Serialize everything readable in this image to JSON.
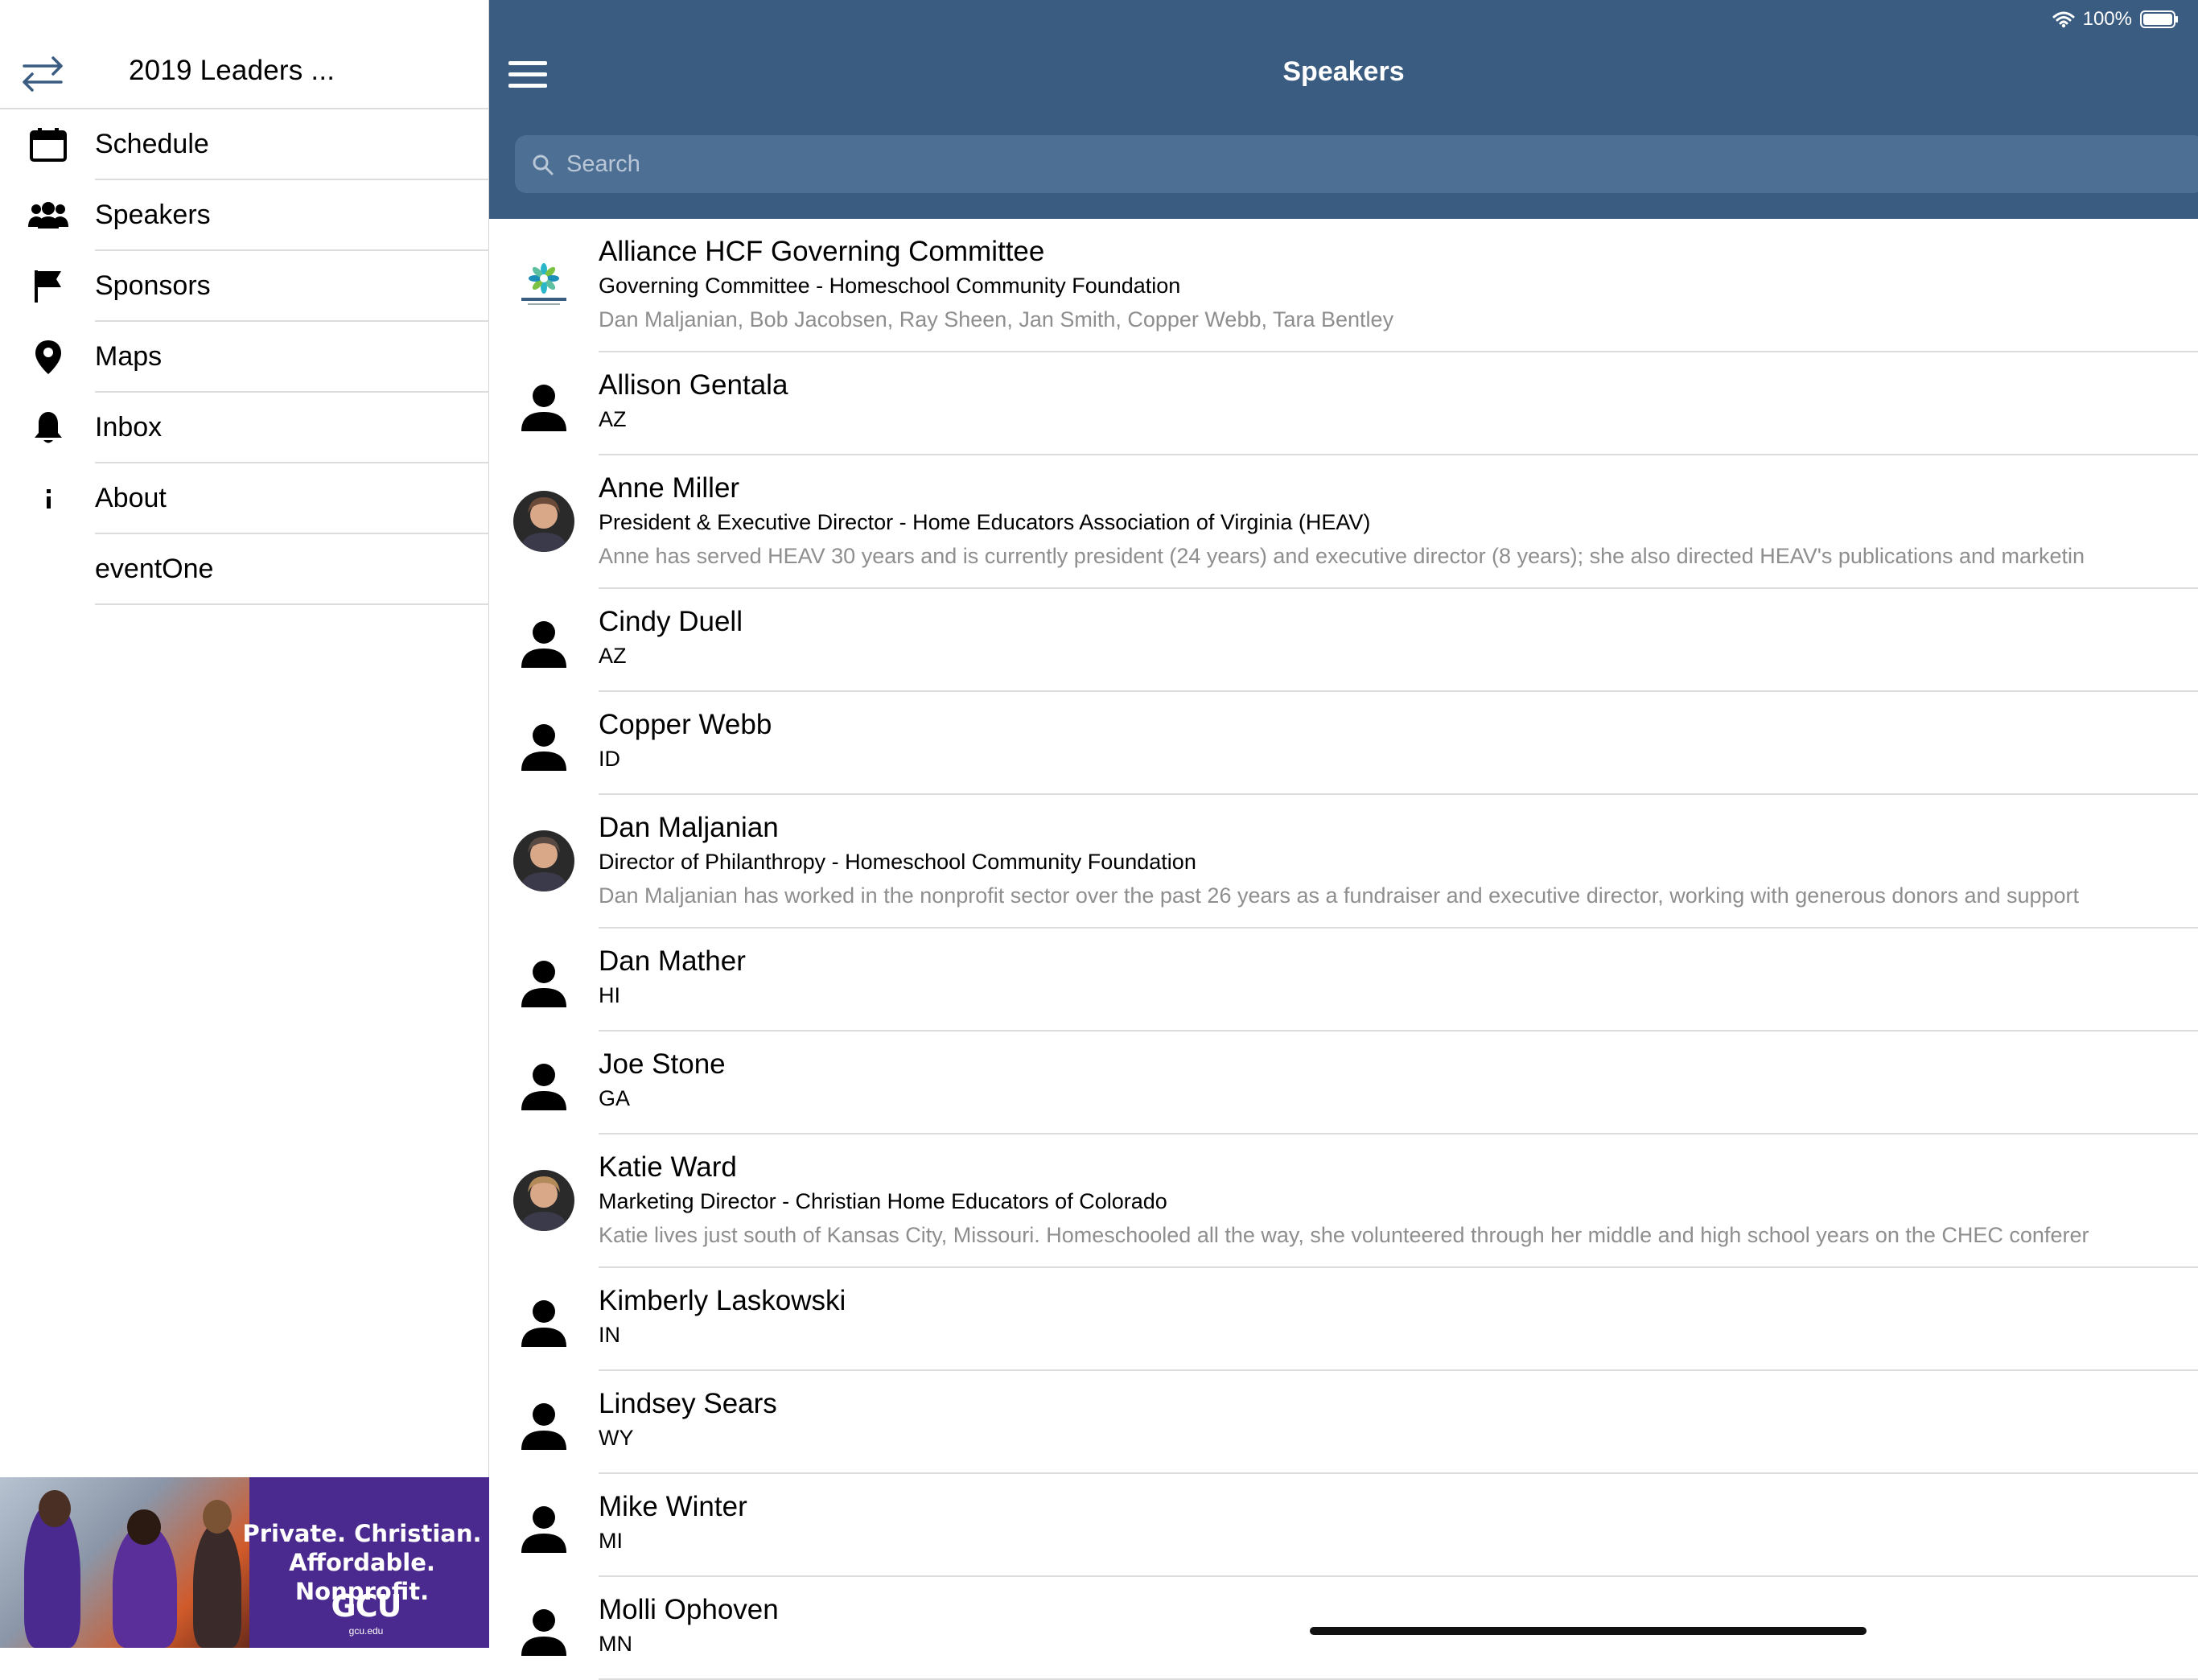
{
  "status": {
    "battery": "100%"
  },
  "sidebar": {
    "title": "2019 Leaders ...",
    "items": [
      {
        "label": "Schedule",
        "icon": "calendar-icon"
      },
      {
        "label": "Speakers",
        "icon": "people-icon"
      },
      {
        "label": "Sponsors",
        "icon": "flag-icon"
      },
      {
        "label": "Maps",
        "icon": "map-pin-icon"
      },
      {
        "label": "Inbox",
        "icon": "bell-icon"
      },
      {
        "label": "About",
        "icon": "info-icon"
      },
      {
        "label": "eventOne",
        "icon": ""
      }
    ],
    "ad": {
      "line1": "Private. Christian.",
      "line2": "Affordable. Nonprofit.",
      "logo": "GCU",
      "url": "gcu.edu"
    }
  },
  "header": {
    "title": "Speakers"
  },
  "search": {
    "placeholder": "Search"
  },
  "speakers": [
    {
      "name": "Alliance HCF Governing Committee",
      "subtitle": "Governing Committee - Homeschool Community Foundation",
      "description": "Dan Maljanian, Bob Jacobsen, Ray Sheen, Jan Smith, Copper Webb, Tara Bentley",
      "avatar": "homeschool-logo"
    },
    {
      "name": "Allison Gentala",
      "subtitle": "AZ",
      "description": "",
      "avatar": "person"
    },
    {
      "name": "Anne Miller",
      "subtitle": "President & Executive Director - Home Educators Association of Virginia (HEAV)",
      "description": "Anne has served HEAV 30 years and is currently president (24 years) and executive director (8 years); she also directed HEAV's publications and marketin",
      "avatar": "photo"
    },
    {
      "name": "Cindy Duell",
      "subtitle": "AZ",
      "description": "",
      "avatar": "person"
    },
    {
      "name": "Copper Webb",
      "subtitle": "ID",
      "description": "",
      "avatar": "person"
    },
    {
      "name": "Dan Maljanian",
      "subtitle": "Director of Philanthropy - Homeschool Community Foundation",
      "description": "Dan Maljanian has worked in the nonprofit sector over the past 26 years as a fundraiser and executive director, working with generous donors and support",
      "avatar": "photo"
    },
    {
      "name": "Dan Mather",
      "subtitle": "HI",
      "description": "",
      "avatar": "person"
    },
    {
      "name": "Joe Stone",
      "subtitle": "GA",
      "description": "",
      "avatar": "person"
    },
    {
      "name": "Katie Ward",
      "subtitle": "Marketing Director - Christian Home Educators of Colorado",
      "description": "Katie lives just south of Kansas City, Missouri. Homeschooled all the way, she volunteered through her middle and high school years on the CHEC conferer",
      "avatar": "photo"
    },
    {
      "name": "Kimberly Laskowski",
      "subtitle": "IN",
      "description": "",
      "avatar": "person"
    },
    {
      "name": "Lindsey Sears",
      "subtitle": "WY",
      "description": "",
      "avatar": "person"
    },
    {
      "name": "Mike Winter",
      "subtitle": "MI",
      "description": "",
      "avatar": "person"
    },
    {
      "name": "Molli Ophoven",
      "subtitle": "MN",
      "description": "",
      "avatar": "person"
    }
  ]
}
